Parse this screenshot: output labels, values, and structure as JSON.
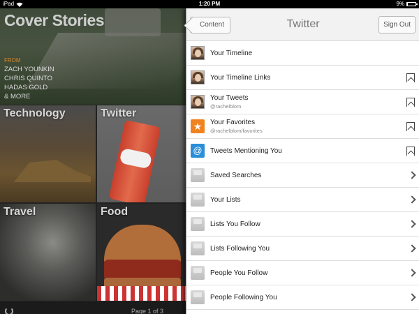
{
  "status_bar": {
    "carrier": "iPad",
    "time": "1:20 PM",
    "battery": "9%",
    "battery_level": 0.09
  },
  "cover": {
    "title": "Cover Stories",
    "from_label": "FROM",
    "authors": [
      "ZACH YOUNKIN",
      "CHRIS QUINTO",
      "HADAS GOLD",
      "& MORE"
    ]
  },
  "tiles": {
    "technology": "Technology",
    "twitter": "Twitter",
    "travel": "Travel",
    "food": "Food"
  },
  "footer": {
    "page_indicator": "Page 1 of 3"
  },
  "panel": {
    "back_label": "Content",
    "title": "Twitter",
    "signout_label": "Sign Out",
    "items": [
      {
        "title": "Your Timeline",
        "subtitle": "",
        "icon": "avatar-icon",
        "accessory": "none"
      },
      {
        "title": "Your Timeline Links",
        "subtitle": "",
        "icon": "avatar-icon",
        "accessory": "bookmark-icon"
      },
      {
        "title": "Your Tweets",
        "subtitle": "@rachelblom",
        "icon": "avatar-icon",
        "accessory": "bookmark-icon"
      },
      {
        "title": "Your Favorites",
        "subtitle": "@rachelblom/favorites",
        "icon": "star-icon",
        "accessory": "bookmark-icon"
      },
      {
        "title": "Tweets Mentioning You",
        "subtitle": "",
        "icon": "at-icon",
        "accessory": "bookmark-icon"
      },
      {
        "title": "Saved Searches",
        "subtitle": "",
        "icon": "tray-icon",
        "accessory": "chevron-right-icon"
      },
      {
        "title": "Your Lists",
        "subtitle": "",
        "icon": "tray-icon",
        "accessory": "chevron-right-icon"
      },
      {
        "title": "Lists You Follow",
        "subtitle": "",
        "icon": "tray-icon",
        "accessory": "chevron-right-icon"
      },
      {
        "title": "Lists Following You",
        "subtitle": "",
        "icon": "tray-icon",
        "accessory": "chevron-right-icon"
      },
      {
        "title": "People You Follow",
        "subtitle": "",
        "icon": "tray-icon",
        "accessory": "chevron-right-icon"
      },
      {
        "title": "People Following You",
        "subtitle": "",
        "icon": "tray-icon",
        "accessory": "chevron-right-icon"
      }
    ]
  },
  "colors": {
    "accent_orange": "#f0821f",
    "at_blue": "#2a8ed9",
    "from_label": "#d98a2a"
  }
}
